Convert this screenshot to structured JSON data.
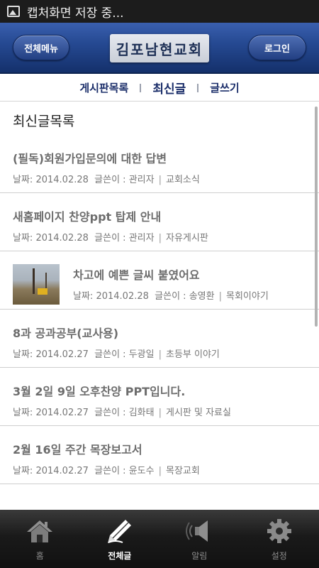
{
  "status_bar": {
    "text": "캡처화면 저장 중..."
  },
  "header": {
    "menu_label": "전체메뉴",
    "title": "김포남현교회",
    "login_label": "로그인"
  },
  "nav": {
    "tabs": [
      {
        "label": "게시판목록"
      },
      {
        "label": "최신글"
      },
      {
        "label": "글쓰기"
      }
    ]
  },
  "main": {
    "section_title": "최신글목록",
    "meta_labels": {
      "date": "날짜:",
      "author": "글쓴이 :"
    },
    "posts": [
      {
        "title": "(필독)회원가입문의에 대한 답변",
        "date": "2014.02.28",
        "author": "관리자",
        "board": "교회소식"
      },
      {
        "title": "새홈페이지 찬양ppt 탑제 안내",
        "date": "2014.02.28",
        "author": "관리자",
        "board": "자유게시판"
      },
      {
        "title": "차고에 예쁜 글씨 붙였어요",
        "date": "2014.02.28",
        "author": "송영환",
        "board": "목회이야기"
      },
      {
        "title": "8과 공과공부(교사용)",
        "date": "2014.02.27",
        "author": "두광일",
        "board": "초등부 이야기"
      },
      {
        "title": "3월 2일 9일 오후찬양 PPT입니다.",
        "date": "2014.02.27",
        "author": "김화태",
        "board": "게시판 및 자료실"
      },
      {
        "title": "2월 16일 주간 목장보고서",
        "date": "2014.02.27",
        "author": "윤도수",
        "board": "목장교회"
      }
    ]
  },
  "bottom_bar": {
    "items": [
      {
        "label": "홈",
        "icon": "home-icon"
      },
      {
        "label": "전체글",
        "icon": "pencil-icon"
      },
      {
        "label": "알림",
        "icon": "speaker-icon"
      },
      {
        "label": "설정",
        "icon": "gear-icon"
      }
    ]
  }
}
